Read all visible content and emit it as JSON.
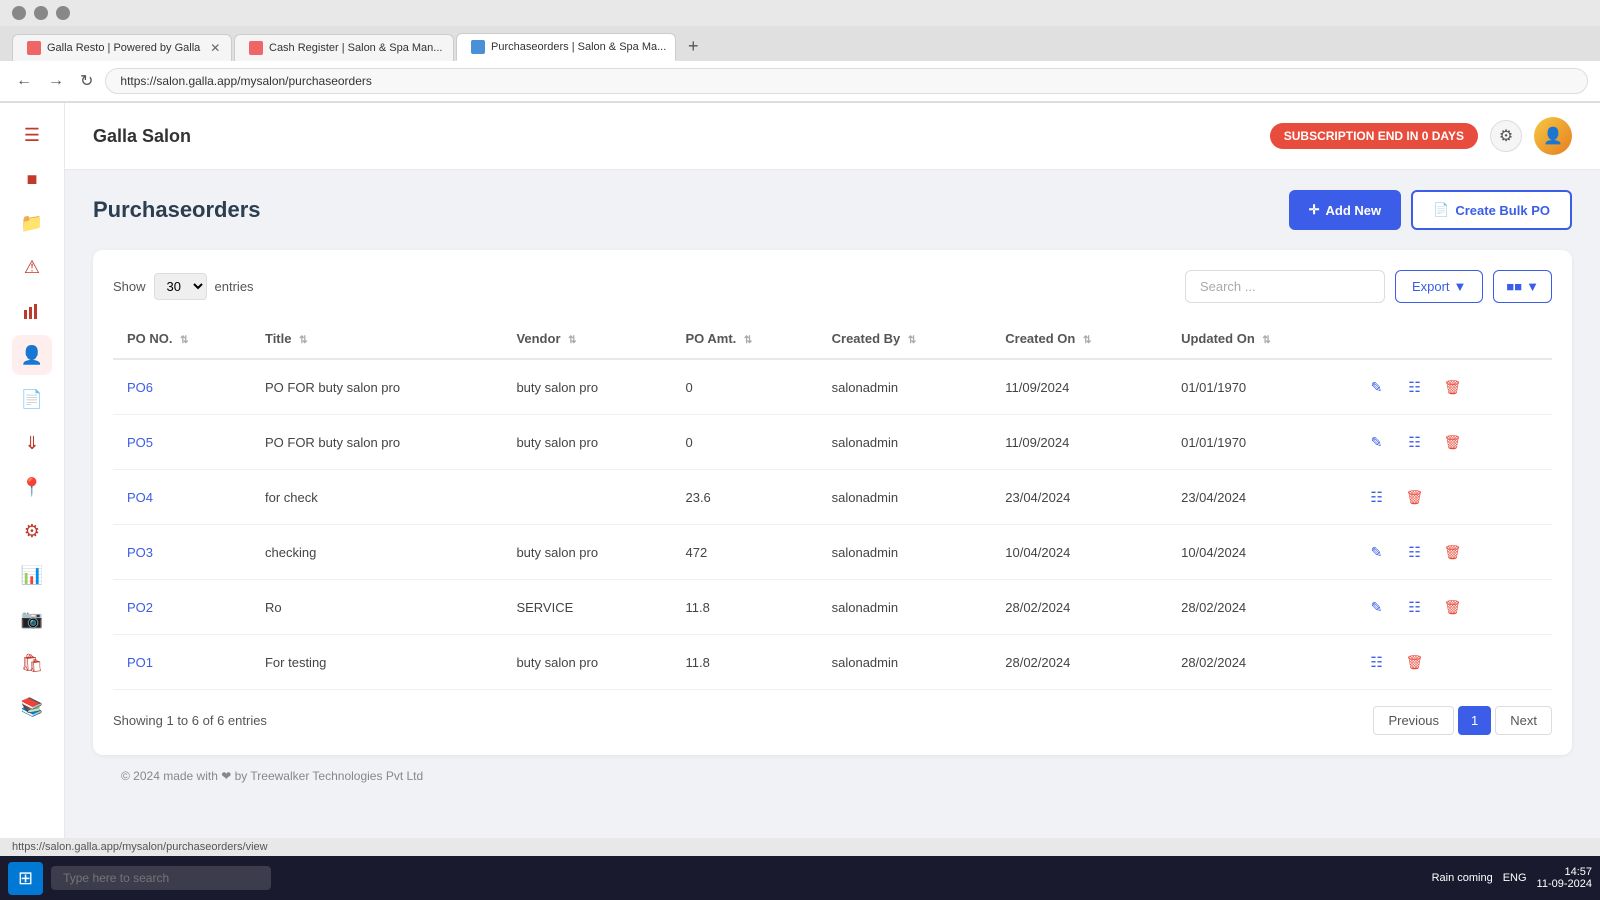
{
  "browser": {
    "address": "https://salon.galla.app/mysalon/purchaseorders",
    "tabs": [
      {
        "label": "Galla Resto | Powered by Galla",
        "active": false,
        "icon": "red"
      },
      {
        "label": "Cash Register | Salon & Spa Man...",
        "active": false,
        "icon": "red"
      },
      {
        "label": "Purchaseorders | Salon & Spa Ma...",
        "active": true,
        "icon": "blue"
      }
    ]
  },
  "app": {
    "title": "Galla Salon",
    "subscription_badge": "SUBSCRIPTION END IN 0 DAYS",
    "page_title": "Purchaseorders"
  },
  "toolbar": {
    "add_new_label": "Add New",
    "create_bulk_label": "Create Bulk PO"
  },
  "table": {
    "show_label": "Show",
    "entries_label": "entries",
    "show_count": "30",
    "search_placeholder": "Search ...",
    "export_label": "Export",
    "columns": [
      "PO NO.",
      "Title",
      "Vendor",
      "PO Amt.",
      "Created By",
      "Created On",
      "Updated On",
      ""
    ],
    "rows": [
      {
        "po_no": "PO6",
        "title": "PO FOR buty salon pro",
        "vendor": "buty salon pro",
        "po_amt": "0",
        "created_by": "salonadmin",
        "created_on": "11/09/2024",
        "updated_on": "01/01/1970",
        "has_edit": true,
        "has_view": true,
        "has_delete": true
      },
      {
        "po_no": "PO5",
        "title": "PO FOR buty salon pro",
        "vendor": "buty salon pro",
        "po_amt": "0",
        "created_by": "salonadmin",
        "created_on": "11/09/2024",
        "updated_on": "01/01/1970",
        "has_edit": true,
        "has_view": true,
        "has_delete": true
      },
      {
        "po_no": "PO4",
        "title": "for check",
        "vendor": "",
        "po_amt": "23.6",
        "created_by": "salonadmin",
        "created_on": "23/04/2024",
        "updated_on": "23/04/2024",
        "has_edit": false,
        "has_view": true,
        "has_delete": true
      },
      {
        "po_no": "PO3",
        "title": "checking",
        "vendor": "buty salon pro",
        "po_amt": "472",
        "created_by": "salonadmin",
        "created_on": "10/04/2024",
        "updated_on": "10/04/2024",
        "has_edit": true,
        "has_view": true,
        "has_delete": true
      },
      {
        "po_no": "PO2",
        "title": "Ro",
        "vendor": "SERVICE",
        "po_amt": "11.8",
        "created_by": "salonadmin",
        "created_on": "28/02/2024",
        "updated_on": "28/02/2024",
        "has_edit": true,
        "has_view": true,
        "has_delete": true
      },
      {
        "po_no": "PO1",
        "title": "For testing",
        "vendor": "buty salon pro",
        "po_amt": "11.8",
        "created_by": "salonadmin",
        "created_on": "28/02/2024",
        "updated_on": "28/02/2024",
        "has_edit": false,
        "has_view": true,
        "has_delete": true
      }
    ],
    "showing_text": "Showing 1 to 6 of 6 entries"
  },
  "pagination": {
    "previous_label": "Previous",
    "next_label": "Next",
    "current_page": "1"
  },
  "footer": {
    "text": "© 2024 made with ❤ by Treewalker Technologies Pvt Ltd"
  },
  "status_bar": {
    "url": "https://salon.galla.app/mysalon/purchaseorders/view"
  },
  "taskbar": {
    "search_placeholder": "Type here to search",
    "time": "14:57",
    "date": "11-09-2024",
    "weather": "Rain coming",
    "language": "ENG"
  }
}
